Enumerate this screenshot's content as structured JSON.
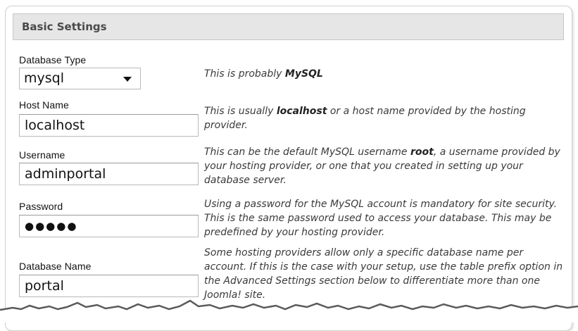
{
  "section": {
    "title": "Basic Settings"
  },
  "fields": {
    "database_type": {
      "label": "Database Type",
      "value": "mysql",
      "help_prefix": "This is probably ",
      "help_bold": "MySQL",
      "help_suffix": ""
    },
    "host_name": {
      "label": "Host Name",
      "value": "localhost",
      "help_prefix": "This is usually ",
      "help_bold": "localhost",
      "help_suffix": " or a host name provided by the hosting provider."
    },
    "username": {
      "label": "Username",
      "value": "adminportal",
      "help_prefix": "This can be the default MySQL username ",
      "help_bold": "root",
      "help_suffix": ", a username provided by your hosting provider, or one that you created in setting up your database server."
    },
    "password": {
      "label": "Password",
      "value": "●●●●●",
      "help": "Using a password for the MySQL account is mandatory for site security. This is the same password used to access your database. This may be predefined by your hosting provider."
    },
    "database_name": {
      "label": "Database Name",
      "value": "portal",
      "help": "Some hosting providers allow only a specific database name per account. If this is the case with your setup, use the table prefix option in the Advanced Settings section below to differentiate more than one Joomla! site."
    }
  },
  "icons": {
    "select_arrow": "chevron-down-icon"
  }
}
